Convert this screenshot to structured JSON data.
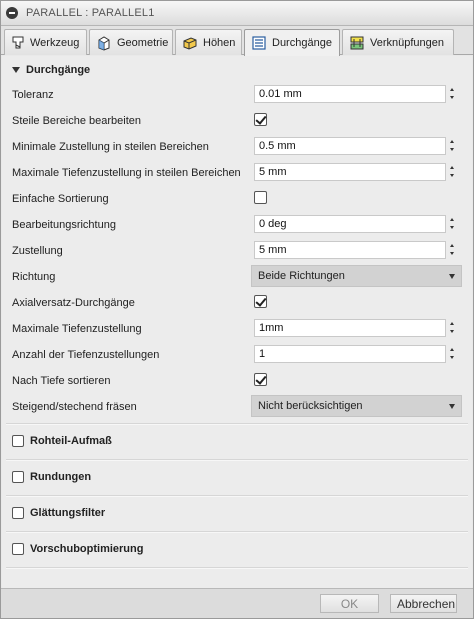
{
  "window": {
    "title": "PARALLEL : PARALLEL1"
  },
  "tabs": [
    {
      "label": "Werkzeug",
      "icon": "tool-icon"
    },
    {
      "label": "Geometrie",
      "icon": "geometry-icon"
    },
    {
      "label": "Höhen",
      "icon": "heights-icon"
    },
    {
      "label": "Durchgänge",
      "icon": "passes-icon",
      "active": true
    },
    {
      "label": "Verknüpfungen",
      "icon": "linking-icon"
    }
  ],
  "section": {
    "title": "Durchgänge",
    "rows": [
      {
        "label": "Toleranz",
        "type": "spin",
        "value": "0.01 mm"
      },
      {
        "label": "Steile Bereiche bearbeiten",
        "type": "check",
        "checked": true
      },
      {
        "label": "Minimale Zustellung in steilen Bereichen",
        "type": "spin",
        "value": "0.5 mm"
      },
      {
        "label": "Maximale Tiefenzustellung in steilen Bereichen",
        "type": "spin",
        "value": "5 mm"
      },
      {
        "label": "Einfache Sortierung",
        "type": "check",
        "checked": false
      },
      {
        "label": "Bearbeitungsrichtung",
        "type": "spin",
        "value": "0 deg"
      },
      {
        "label": "Zustellung",
        "type": "spin",
        "value": "5 mm"
      },
      {
        "label": "Richtung",
        "type": "select",
        "value": "Beide Richtungen"
      },
      {
        "label": "Axialversatz-Durchgänge",
        "type": "check",
        "checked": true
      },
      {
        "label": "Maximale Tiefenzustellung",
        "type": "spin",
        "value": "1mm"
      },
      {
        "label": "Anzahl der Tiefenzustellungen",
        "type": "spin",
        "value": "1"
      },
      {
        "label": "Nach Tiefe sortieren",
        "type": "check",
        "checked": true
      },
      {
        "label": "Steigend/stechend fräsen",
        "type": "select",
        "value": "Nicht berücksichtigen"
      }
    ]
  },
  "collapsed_sections": [
    {
      "label": "Rohteil-Aufmaß",
      "checked": false
    },
    {
      "label": "Rundungen",
      "checked": false
    },
    {
      "label": "Glättungsfilter",
      "checked": false
    },
    {
      "label": "Vorschuboptimierung",
      "checked": false
    }
  ],
  "footer": {
    "ok_label": "OK",
    "cancel_label": "Abbrechen"
  }
}
